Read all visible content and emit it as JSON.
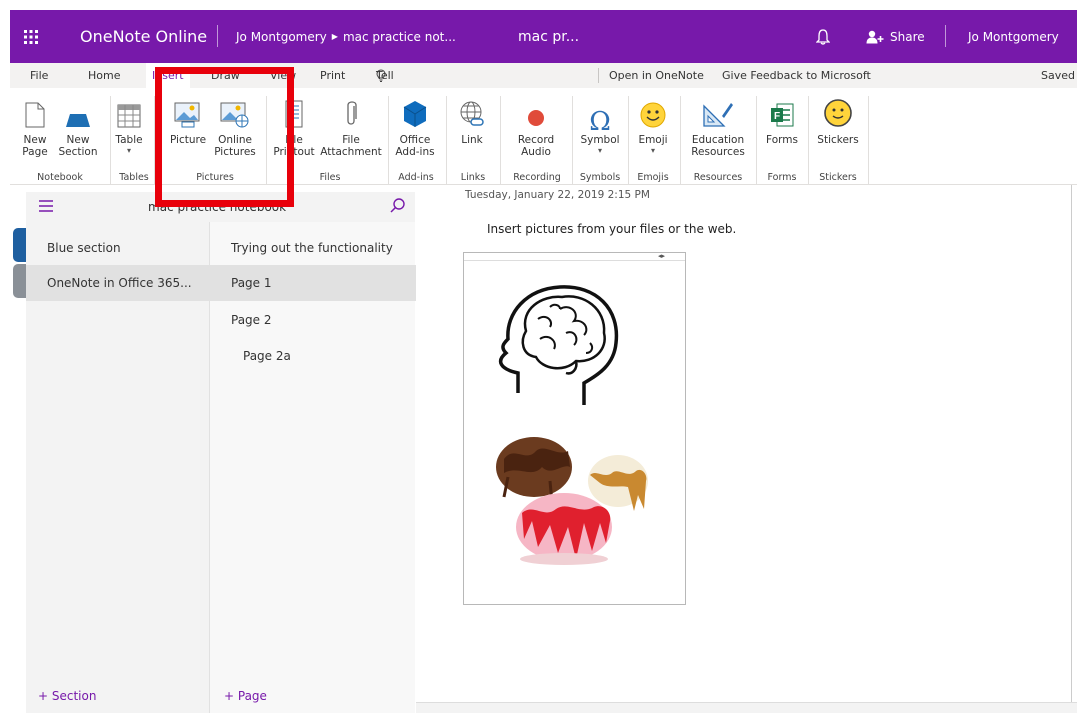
{
  "titlebar": {
    "app_name": "OneNote Online",
    "breadcrumb_user": "Jo Montgomery",
    "breadcrumb_notebook": "mac practice not...",
    "page_title": "mac pr...",
    "share_label": "Share",
    "user_name": "Jo Montgomery",
    "bg_color": "#7719aa"
  },
  "tabs": {
    "items": [
      "File",
      "Home",
      "Insert",
      "Draw",
      "View",
      "Print"
    ],
    "active": "Insert",
    "tell_me": "Tell me what you want to do",
    "open_in": "Open in OneNote",
    "feedback": "Give Feedback to Microsoft",
    "status": "Saved"
  },
  "ribbon": {
    "new_page": [
      "New",
      "Page"
    ],
    "new_section": [
      "New",
      "Section"
    ],
    "table": "Table",
    "picture": "Picture",
    "online_pictures": [
      "Online",
      "Pictures"
    ],
    "file_printout": [
      "File",
      "Printout"
    ],
    "file_attachment": [
      "File",
      "Attachment"
    ],
    "office_addins": [
      "Office",
      "Add-ins"
    ],
    "link": "Link",
    "record_audio": [
      "Record",
      "Audio"
    ],
    "symbol": "Symbol",
    "emoji": "Emoji",
    "education_resources": [
      "Education",
      "Resources"
    ],
    "forms": "Forms",
    "stickers": "Stickers",
    "groups": {
      "notebook": "Notebook",
      "tables": "Tables",
      "pictures": "Pictures",
      "files": "Files",
      "addins": "Add-ins",
      "links": "Links",
      "recording": "Recording",
      "symbols": "Symbols",
      "emojis": "Emojis",
      "resources": "Resources",
      "forms": "Forms",
      "stickers": "Stickers"
    }
  },
  "navigation": {
    "notebook_name": "mac practice notebook",
    "sections": [
      "Blue section",
      "OneNote in Office 365..."
    ],
    "selected_section": "OneNote in Office 365...",
    "pages": [
      "Trying out the functionality",
      "Page 1",
      "Page 2",
      "Page 2a"
    ],
    "selected_page": "Page 1",
    "add_section": "+ Section",
    "add_page": "+ Page"
  },
  "canvas": {
    "timestamp": "Tuesday, January 22, 2019   2:15 PM",
    "instruction": "Insert pictures from your files or the web.",
    "images": [
      "brain-head-outline",
      "ice-cream-scoops"
    ]
  },
  "highlight_color": "#e8000b"
}
